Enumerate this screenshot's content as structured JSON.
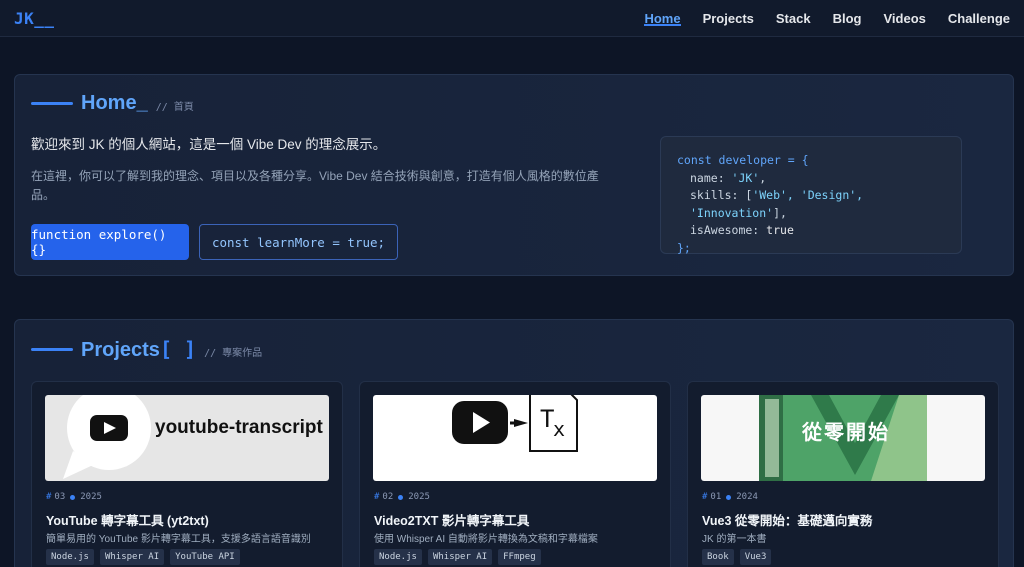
{
  "nav": {
    "logo": "JK__",
    "items": [
      {
        "label": "Home",
        "active": true
      },
      {
        "label": "Projects"
      },
      {
        "label": "Stack"
      },
      {
        "label": "Blog"
      },
      {
        "label": "Videos"
      },
      {
        "label": "Challenge"
      }
    ]
  },
  "home": {
    "title": "Home_",
    "subtitle": "// 首頁",
    "welcome": "歡迎來到 JK 的個人網站，這是一個 Vibe Dev 的理念展示。",
    "description": "在這裡，你可以了解到我的理念、項目以及各種分享。Vibe Dev 結合技術與創意，打造有個人風格的數位產品。",
    "primary_button": "function explore() {}",
    "secondary_button": "const learnMore = true;",
    "code": {
      "line1_kw": "const developer = {",
      "name_key": "name: ",
      "name_val": "'JK'",
      "skills_key": "skills: [",
      "skills_vals": "'Web', 'Design', 'Innovation'",
      "skills_end": "],",
      "awesome_key": "isAwesome: ",
      "awesome_val": "true",
      "close": "};"
    }
  },
  "projects": {
    "title": "Projects",
    "title_bracket": "[ ]",
    "subtitle": "// 專案作品",
    "items": [
      {
        "number": "03",
        "year": "2025",
        "title": "YouTube 轉字幕工具 (yt2txt)",
        "description": "簡單易用的 YouTube 影片轉字幕工具，支援多語言語音識別",
        "tags": [
          "Node.js",
          "Whisper AI",
          "YouTube API"
        ],
        "image_text": "youtube-transcript"
      },
      {
        "number": "02",
        "year": "2025",
        "title": "Video2TXT 影片轉字幕工具",
        "description": "使用 Whisper AI 自動將影片轉換為文稿和字幕檔案",
        "tags": [
          "Node.js",
          "Whisper AI",
          "FFmpeg"
        ],
        "image_text": "T"
      },
      {
        "number": "01",
        "year": "2024",
        "title": "Vue3 從零開始：基礎邁向實務",
        "description": "JK 的第一本書",
        "tags": [
          "Book",
          "Vue3"
        ],
        "image_text": "從零開始"
      }
    ]
  }
}
